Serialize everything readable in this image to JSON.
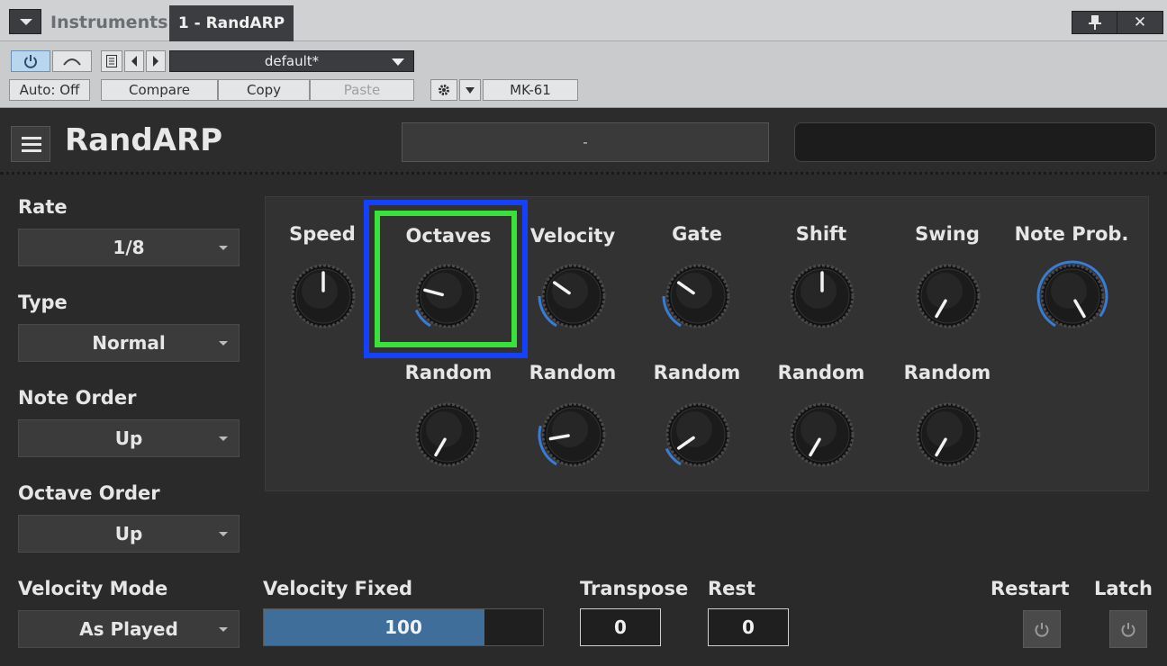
{
  "window": {
    "menu_icon": "chevron-down-icon",
    "tabs": [
      {
        "label": "Instruments"
      },
      {
        "label": "1 - RandARP"
      }
    ],
    "pin_icon": "pin-icon",
    "close_label": "✕"
  },
  "toolbar": {
    "power_icon": "power-icon",
    "bypass_icon": "bypass-icon",
    "preset_name": "default*",
    "auto_label": "Auto: Off",
    "compare_label": "Compare",
    "copy_label": "Copy",
    "paste_label": "Paste",
    "gear_icon": "gear-icon",
    "device_label": "MK-61"
  },
  "plugin": {
    "title": "RandARP",
    "header_field": "-",
    "accent_color": "#3f6e9a"
  },
  "left": {
    "rate": {
      "label": "Rate",
      "value": "1/8"
    },
    "type": {
      "label": "Type",
      "value": "Normal"
    },
    "note_order": {
      "label": "Note Order",
      "value": "Up"
    },
    "octave_order": {
      "label": "Octave Order",
      "value": "Up"
    },
    "velocity_mode": {
      "label": "Velocity Mode",
      "value": "As Played"
    }
  },
  "knobs": {
    "top": [
      {
        "label": "Speed"
      },
      {
        "label": "Octaves"
      },
      {
        "label": "Velocity"
      },
      {
        "label": "Gate"
      },
      {
        "label": "Shift"
      },
      {
        "label": "Swing"
      },
      {
        "label": "Note Prob."
      }
    ],
    "random": [
      {
        "label": "Random"
      },
      {
        "label": "Random"
      },
      {
        "label": "Random"
      },
      {
        "label": "Random"
      },
      {
        "label": "Random"
      }
    ]
  },
  "bottom": {
    "velocity_fixed": {
      "label": "Velocity Fixed",
      "value": "100",
      "fill_fraction": 0.79
    },
    "transpose": {
      "label": "Transpose",
      "value": "0"
    },
    "rest": {
      "label": "Rest",
      "value": "0"
    },
    "restart": {
      "label": "Restart"
    },
    "latch": {
      "label": "Latch"
    }
  }
}
